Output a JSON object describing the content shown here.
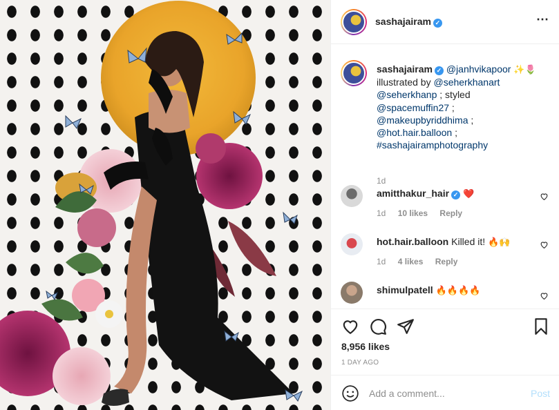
{
  "post": {
    "author": "sashajairam",
    "more_icon": "⋯"
  },
  "caption": {
    "author": "sashajairam",
    "line1_mention": "@janhvikapoor",
    "line1_emoji": "✨🌷",
    "line2_text": "illustrated by ",
    "line2_mention": "@seherkhanart",
    "line3_mention": "@seherkhanp",
    "line3_text": " ; styled",
    "line4_mention": "@spacemuffin27",
    "line4_text": " ;",
    "line5_mention": "@makeupbyriddhima",
    "line5_text": " ;",
    "line6_mention": "@hot.hair.balloon",
    "line6_text": " ;",
    "line7_tag": "#sashajairamphotography",
    "time": "1d"
  },
  "comments": [
    {
      "user": "amitthakur_hair",
      "verified": true,
      "text": "",
      "emoji": "❤️",
      "time": "1d",
      "likes": "10 likes",
      "reply": "Reply"
    },
    {
      "user": "hot.hair.balloon",
      "verified": false,
      "text": "Killed it!",
      "emoji": "🔥🙌",
      "time": "1d",
      "likes": "4 likes",
      "reply": "Reply"
    },
    {
      "user": "shimulpatell",
      "verified": false,
      "text": "",
      "emoji": "🔥🔥🔥🔥",
      "time": "",
      "likes": "",
      "reply": ""
    }
  ],
  "actions": {
    "likes": "8,956 likes",
    "posted": "1 DAY AGO"
  },
  "add_comment": {
    "placeholder": "Add a comment...",
    "post_label": "Post"
  },
  "colors": {
    "link": "#00376b",
    "verified": "#3897f0",
    "muted": "#8e8e8e",
    "post_disabled": "#b2dffc"
  },
  "icons": [
    "heart-icon",
    "comment-icon",
    "share-icon",
    "bookmark-icon",
    "smile-icon",
    "verified-badge-icon",
    "more-options-icon"
  ]
}
